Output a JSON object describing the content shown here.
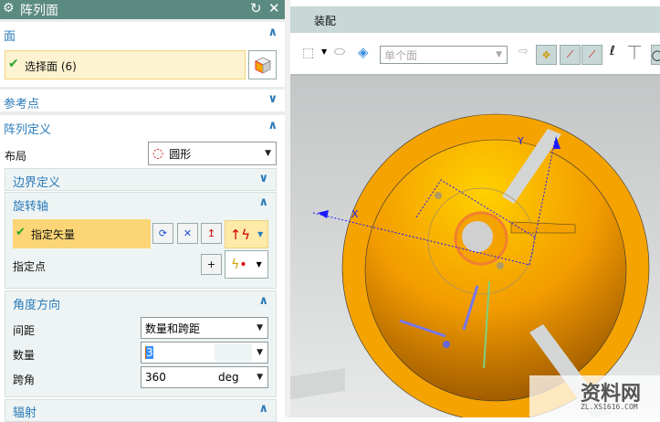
{
  "dialog": {
    "title": "阵列面",
    "icons": [
      "gear-icon",
      "reset-icon",
      "close-icon"
    ]
  },
  "face_section": {
    "header": "面",
    "select_label": "选择面 (6)"
  },
  "reference_point": {
    "header": "参考点"
  },
  "array_def": {
    "header": "阵列定义",
    "layout_label": "布局",
    "layout_value": "圆形",
    "boundary": {
      "header": "边界定义"
    },
    "rotation_axis": {
      "header": "旋转轴",
      "vector_label": "指定矢量",
      "point_label": "指定点"
    },
    "angle": {
      "header": "角度方向",
      "spacing_label": "间距",
      "spacing_value": "数量和跨距",
      "count_label": "数量",
      "count_value": "3",
      "span_label": "跨角",
      "span_value": "360",
      "span_unit": "deg"
    },
    "radial": {
      "header": "辐射"
    }
  },
  "menubar": {
    "item": "装配"
  },
  "toolbar": {
    "filter_placeholder": "单个面"
  },
  "viewport": {
    "axis_x": "X",
    "axis_y": "Y",
    "colors": {
      "part": "#f5a300",
      "highlight": "#ffcc00",
      "csys": "#1a1aff"
    }
  },
  "watermark": {
    "text": "资料网",
    "url": "ZL.XS1616.COM"
  }
}
